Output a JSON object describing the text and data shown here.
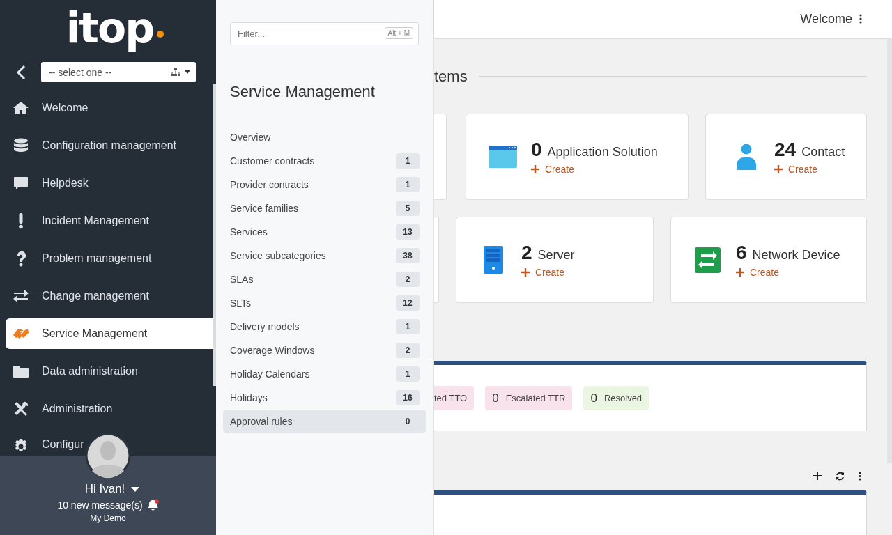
{
  "sidebar": {
    "logo": "itop",
    "org_select": {
      "value": "-- select one --"
    },
    "nav": [
      {
        "label": "Welcome",
        "kind": "home",
        "selected": false
      },
      {
        "label": "Configuration management",
        "kind": "database",
        "selected": false
      },
      {
        "label": "Helpdesk",
        "kind": "comment",
        "selected": false
      },
      {
        "label": "Incident Management",
        "kind": "exclamation",
        "selected": false
      },
      {
        "label": "Problem management",
        "kind": "question",
        "selected": false
      },
      {
        "label": "Change management",
        "kind": "arrows",
        "selected": false
      },
      {
        "label": "Service Management",
        "kind": "handshake",
        "selected": true
      },
      {
        "label": "Data administration",
        "kind": "folder",
        "selected": false
      },
      {
        "label": "Administration",
        "kind": "tools",
        "selected": false
      },
      {
        "label": "Configur",
        "kind": "gear",
        "selected": false
      }
    ],
    "user": {
      "greeting": "Hi Ivan!",
      "messages": "10 new message(s)",
      "unread": true,
      "organization": "My Demo"
    }
  },
  "flyout": {
    "filter": {
      "placeholder": "Filter...",
      "shortcut": "Alt + M"
    },
    "title": "Service Management",
    "items": [
      {
        "label": "Overview",
        "selected": false
      },
      {
        "label": "Customer contracts",
        "count": "1",
        "selected": false
      },
      {
        "label": "Provider contracts",
        "count": "1",
        "selected": false
      },
      {
        "label": "Service families",
        "count": "5",
        "selected": false
      },
      {
        "label": "Services",
        "count": "13",
        "selected": false
      },
      {
        "label": "Service subcategories",
        "count": "38",
        "selected": false
      },
      {
        "label": "SLAs",
        "count": "2",
        "selected": false
      },
      {
        "label": "SLTs",
        "count": "12",
        "selected": false
      },
      {
        "label": "Delivery models",
        "count": "1",
        "selected": false
      },
      {
        "label": "Coverage Windows",
        "count": "2",
        "selected": false
      },
      {
        "label": "Holiday Calendars",
        "count": "1",
        "selected": false
      },
      {
        "label": "Holidays",
        "count": "16",
        "selected": false
      },
      {
        "label": "Approval rules",
        "count": "0",
        "selected": true
      }
    ]
  },
  "header": {
    "title": "Welcome"
  },
  "dashboard": {
    "section_title": "tems",
    "card_rows": [
      [
        {
          "kind": "edge"
        },
        {
          "kind": "app",
          "number": "0",
          "label": "Application Solution",
          "action": "Create"
        },
        {
          "kind": "contact",
          "number": "24",
          "label": "Contact",
          "action": "Create"
        }
      ],
      [
        {
          "kind": "edge"
        },
        {
          "kind": "server",
          "number": "2",
          "label": "Server",
          "action": "Create"
        },
        {
          "kind": "network",
          "number": "6",
          "label": "Network Device",
          "action": "Create"
        }
      ]
    ],
    "status_badges": [
      {
        "kind": "alert",
        "label": "ted TTO"
      },
      {
        "kind": "alert",
        "count": "0",
        "label": "Escalated TTR"
      },
      {
        "kind": "ok",
        "count": "0",
        "label": "Resolved"
      }
    ]
  }
}
